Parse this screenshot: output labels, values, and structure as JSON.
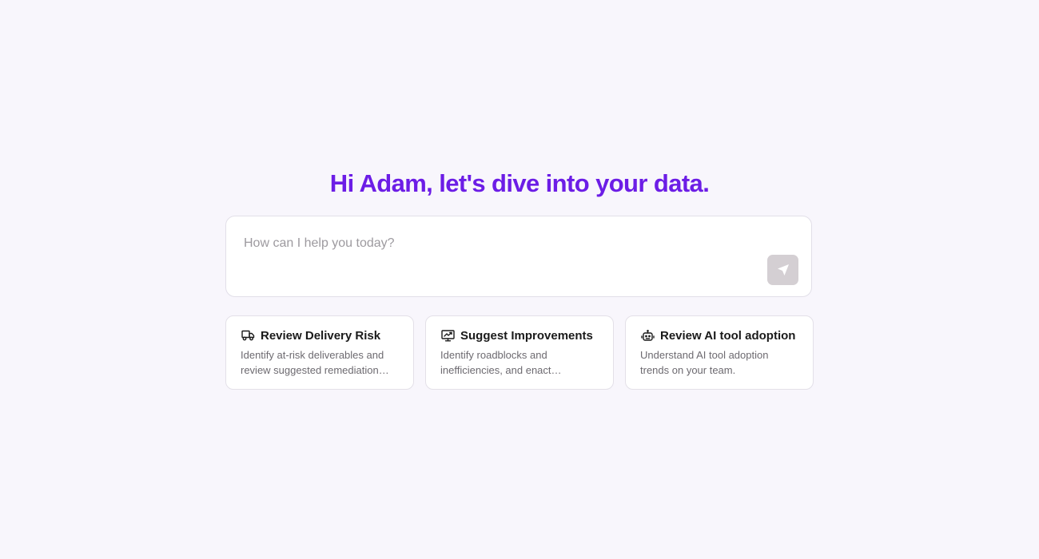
{
  "greeting": "Hi Adam, let's dive into your data.",
  "prompt": {
    "placeholder": "How can I help you today?",
    "value": "",
    "send_icon": "send-icon"
  },
  "suggestions": [
    {
      "icon": "truck-icon",
      "title": "Review Delivery Risk",
      "description": "Identify at-risk deliverables and review suggested remediation steps."
    },
    {
      "icon": "monitor-trend-icon",
      "title": "Suggest Improvements",
      "description": "Identify roadblocks and inefficiencies, and enact improvements."
    },
    {
      "icon": "robot-icon",
      "title": "Review AI tool adoption",
      "description": "Understand AI tool adoption trends on your team."
    }
  ],
  "colors": {
    "background": "#f8f6fc",
    "accent": "#6c1de6",
    "send_button": "#d4cfd3"
  }
}
